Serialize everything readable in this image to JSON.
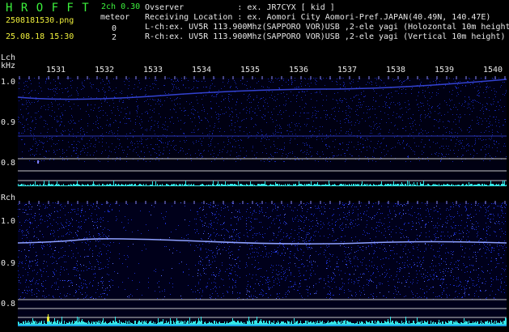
{
  "header": {
    "app_title": "H R O F F T",
    "version": "2ch 0.30",
    "filename": "2508181530.png",
    "meteor_label": "meteor",
    "datetime": "25.08.18 15:30",
    "count_l": "0",
    "count_r": "2"
  },
  "info": {
    "observer": "Ovserver           : ex. JR7CYX [ kid ]",
    "location": "Receiving Location : ex. Aomori City Aomori-Pref.JAPAN(40.49N, 140.47E)",
    "lch": "L-ch:ex. UV5R 113.900Mhz(SAPPORO VOR)USB ,2-ele yagi (Holozontal 10m height)",
    "rch": "R-ch:ex. UV5R 113.900Mhz(SAPPORO VOR)USB ,2-ele yagi (Vertical 10m height)"
  },
  "axes": {
    "lch_label": "Lch",
    "khz_label": "kHz",
    "rch_label": "Rch",
    "x_ticks": [
      "1531",
      "1532",
      "1533",
      "1534",
      "1535",
      "1536",
      "1537",
      "1538",
      "1539",
      "1540"
    ],
    "lch_y_ticks": [
      "1.0",
      "0.9",
      "0.8"
    ],
    "rch_y_ticks": [
      "1.0",
      "0.9",
      "0.8"
    ]
  },
  "colors": {
    "accent_green": "#3cf03c",
    "text_white": "#e8e8e8",
    "label_yellow": "#f0f03c",
    "noise_blue": "#1a2cc8",
    "trace_light": "#8ea0ff",
    "level_cyan": "#33e6e6"
  }
}
